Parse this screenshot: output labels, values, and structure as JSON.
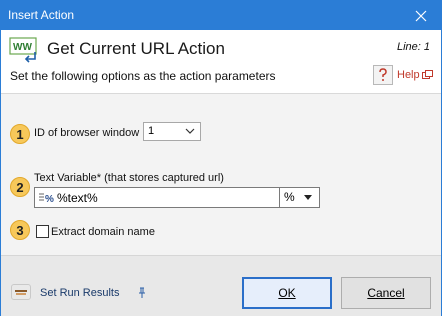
{
  "window": {
    "title": "Insert Action",
    "close_icon": "close-icon"
  },
  "header": {
    "action_icon": "www-icon",
    "title": "Get Current URL Action",
    "line_label": "Line: 1",
    "subtitle": "Set the following options as the action parameters",
    "help_icon": "help-question-icon",
    "help_label": "Help",
    "help_external_icon": "external-window-icon"
  },
  "form": {
    "browser_window": {
      "badge": "1",
      "label": "ID of browser window",
      "value": "1"
    },
    "text_variable": {
      "badge": "2",
      "label": "Text Variable* (that stores captured url)",
      "value": "%text%",
      "variable_menu": "%"
    },
    "extract_domain": {
      "badge": "3",
      "label": "Extract domain name",
      "checked": false
    }
  },
  "footer": {
    "run_results_label": "Set Run Results",
    "ok_label": "OK",
    "cancel_label": "Cancel"
  },
  "colors": {
    "titlebar": "#2b7dd6",
    "badge": "#f7c85a",
    "help_red": "#c0392b",
    "ok_border": "#2b6fc9"
  }
}
